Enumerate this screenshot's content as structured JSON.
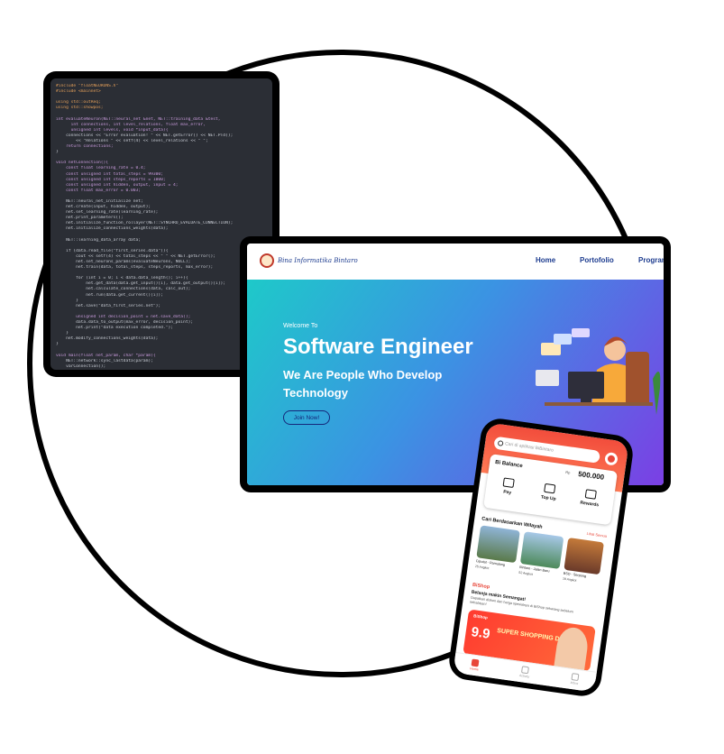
{
  "colors": {
    "accent_red": "#e8473a",
    "nav_blue": "#1d3c8f",
    "hero_gradient_start": "#1ec9c9",
    "hero_gradient_end": "#7b3fe4",
    "code_bg": "#2b2e35"
  },
  "code_editor": {
    "lines": [
      "#include \"floatNEURONS.h\"",
      "#include <mainnet>",
      "",
      "using std::outReq;",
      "using std::showpos;",
      "",
      "int evaluateNeuron(NET::neural_net &net, NET::training_data &test,",
      "      int connections, int level_relations, float max_error,",
      "      unsigned int levels, void *input_data){",
      "    connections << \"Error evaluation! \" << NET.getError() << NET.PTd();",
      "        << \"Relations \" << setf(4) << level_relations << \" \";",
      "    return connections;",
      "}",
      "",
      "void netConnection(){",
      "    const float learning_rate = 0.4;",
      "    const unsigned int total_steps = 99300;",
      "    const unsigned int steps_reports = 1000;",
      "    const unsigned int hidden, output, input = 4;",
      "    const float max_error = 0.003;",
      "",
      "    NET::neural_net_initialize net;",
      "    net.create(input, hidden, output);",
      "    net.set_learning_rate(learning_rate);",
      "    net.print_parameters();",
      "    net.initialize_function_rollayer(NET::SYNCHRO_EVALUATE_CONNECTION);",
      "    net.initialize_connections_weights(data);",
      "",
      "    NET::learning_data_array data;",
      "",
      "    if (data.read_file(\"first_series.data\")){",
      "        cout << setf(4) << total_steps << \" \" << NET.getError();",
      "        net.set_neurons_params(evaluateNeurons, NULL);",
      "        net.train(data, total_steps, steps_reports, max_error);",
      "",
      "        for (int i = 0; i < data.data_length(); i++){",
      "            net.get_data(data.get_input()[i], data.get_output()[i]);",
      "            net.calculate_connections(data, calc_out);",
      "            net.run(data.get_current()[i]);",
      "        }",
      "        net.save(\"data_first_series.net\");",
      "",
      "        unsigned int decision_point = net.save_data();",
      "        data.data_to_output(max_error, decision_point);",
      "        net.print(\"data execution completed.\");",
      "    }",
      "    net.modify_connections_weights(data);",
      "}",
      "",
      "void main(float net_param, char *param){",
      "    NET::network::sync_lastdata(param);",
      "    varConnection();",
      "    authReq << \"Error during execution \";",
      "    NET.print_parameters();"
    ]
  },
  "website": {
    "brand": "Bina Informatika Bintaro",
    "nav": [
      "Home",
      "Portofolio",
      "Programs"
    ],
    "hero": {
      "welcome": "Welcome To",
      "title": "Software Engineer",
      "subtitle": "We Are People Who Develop Technology",
      "cta": "Join Now!"
    }
  },
  "phone_app": {
    "search_placeholder": "Cari di aplikasi BiBintaro",
    "balance_label": "Bi Balance",
    "balance_currency": "Rp",
    "balance_value": "500.000",
    "actions": [
      {
        "label": "Pay",
        "icon": "wallet-icon"
      },
      {
        "label": "Top Up",
        "icon": "topup-icon"
      },
      {
        "label": "Rewards",
        "icon": "crown-icon"
      }
    ],
    "section_title": "Cari Berdasarkan Wilayah",
    "section_more": "Lihat Semua",
    "regions": [
      {
        "name": "Ciputat - Pamulang",
        "sub": "25 Angkot"
      },
      {
        "name": "Bintaro - Jalan Baru",
        "sub": "52 Angkot"
      },
      {
        "name": "BSD - Serpong",
        "sub": "18 Angkot"
      }
    ],
    "shop_brand": "BiShop",
    "shop_heading": "Belanja makin Semangat!",
    "shop_text": "Dapatkan diskon dan harga spesialnya di BiShop sekarang sebelum kehabisan!",
    "banner": {
      "brand": "BiShop",
      "big": "9.9",
      "headline": "SUPER SHOPPING DAY"
    },
    "tabs": [
      {
        "label": "Home",
        "icon": "home-icon"
      },
      {
        "label": "Activity",
        "icon": "activity-icon"
      },
      {
        "label": "Inbox",
        "icon": "inbox-icon"
      }
    ]
  }
}
